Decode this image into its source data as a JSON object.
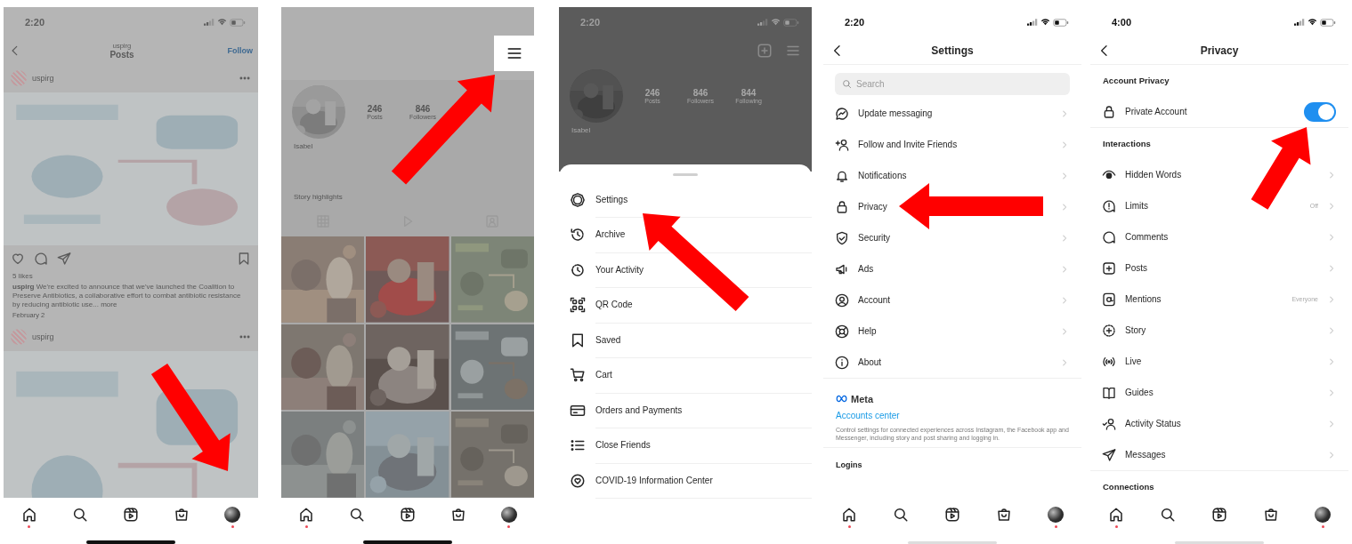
{
  "screens": [
    {
      "kind": "feed",
      "time": "2:20",
      "header_subtitle": "uspirg",
      "header_title": "Posts",
      "follow": "Follow",
      "posts": [
        {
          "author": "uspirg",
          "likes": "5 likes",
          "caption": "**uspirg** We're excited to announce that we've launched the Coalition to Preserve Antibiotics, a collaborative effort to combat antibiotic resistance by reducing antibiotic use...",
          "more": "more",
          "date": "February 2"
        },
        {
          "author": "uspirg"
        }
      ]
    },
    {
      "kind": "profile",
      "stats": [
        {
          "value": "246",
          "label": "Posts"
        },
        {
          "value": "846",
          "label": "Followers"
        }
      ],
      "name": "Isabel",
      "story_highlights": "Story highlights"
    },
    {
      "kind": "menu_sheet",
      "time": "2:20",
      "stats": [
        {
          "value": "246",
          "label": "Posts"
        },
        {
          "value": "846",
          "label": "Followers"
        },
        {
          "value": "844",
          "label": "Following"
        }
      ],
      "name": "Isabel",
      "menu": [
        "Settings",
        "Archive",
        "Your Activity",
        "QR Code",
        "Saved",
        "Cart",
        "Orders and Payments",
        "Close Friends",
        "COVID-19 Information Center"
      ]
    },
    {
      "kind": "settings",
      "time": "2:20",
      "title": "Settings",
      "search": {
        "placeholder": "Search"
      },
      "items": [
        "Update messaging",
        "Follow and Invite Friends",
        "Notifications",
        "Privacy",
        "Security",
        "Ads",
        "Account",
        "Help",
        "About"
      ],
      "brand": "Meta",
      "accounts_center": "Accounts center",
      "description": "Control settings for connected experiences across Instagram, the Facebook app and Messenger, including story and post sharing and logging in.",
      "logins": "Logins"
    },
    {
      "kind": "privacy",
      "time": "4:00",
      "title": "Privacy",
      "sections": [
        {
          "title": "Account Privacy",
          "rows": [
            {
              "kind": "toggle",
              "label": "Private Account",
              "on": true
            }
          ]
        },
        {
          "title": "Interactions",
          "rows": [
            {
              "kind": "link",
              "label": "Hidden Words"
            },
            {
              "kind": "link",
              "label": "Limits",
              "value": "Off"
            },
            {
              "kind": "link",
              "label": "Comments"
            },
            {
              "kind": "link",
              "label": "Posts"
            },
            {
              "kind": "link",
              "label": "Mentions",
              "value": "Everyone"
            },
            {
              "kind": "link",
              "label": "Story"
            },
            {
              "kind": "link",
              "label": "Live"
            },
            {
              "kind": "link",
              "label": "Guides"
            },
            {
              "kind": "link",
              "label": "Activity Status"
            },
            {
              "kind": "link",
              "label": "Messages"
            }
          ]
        },
        {
          "title": "Connections"
        }
      ]
    }
  ]
}
